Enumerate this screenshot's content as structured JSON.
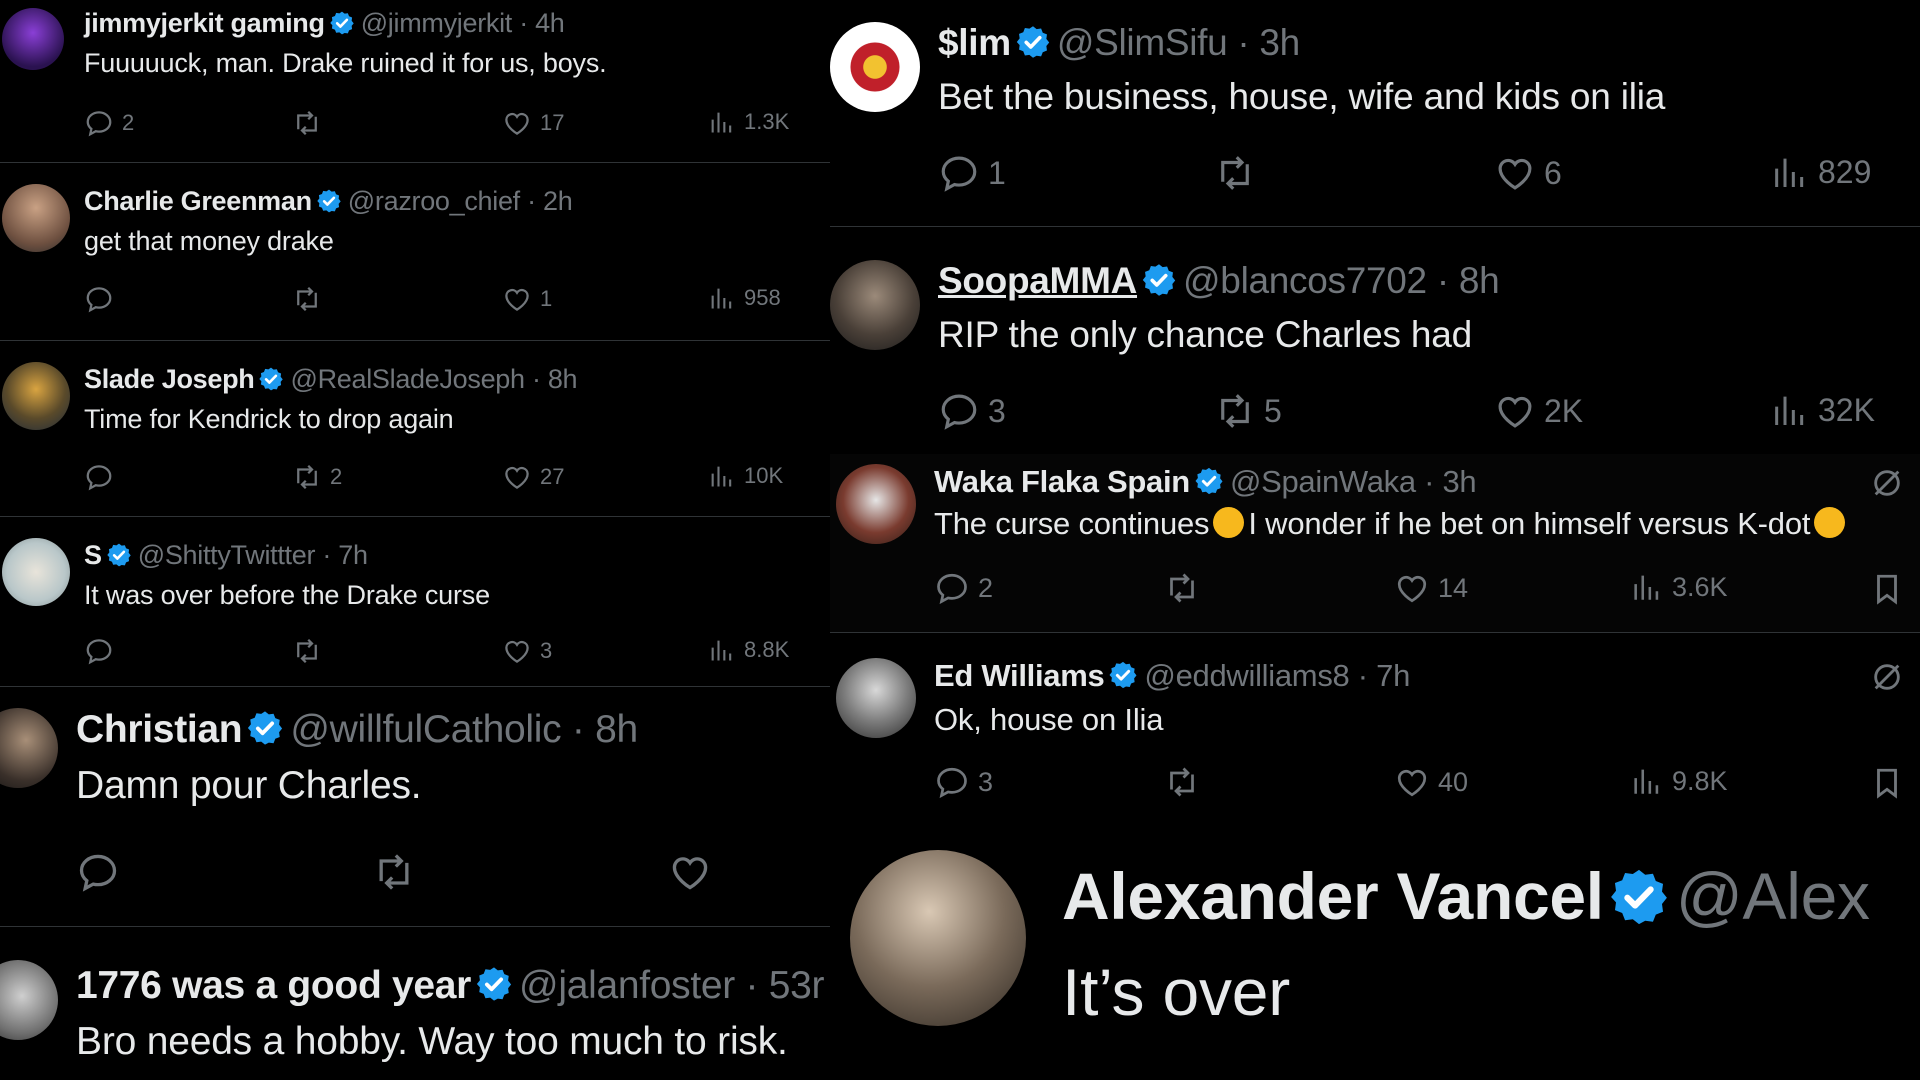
{
  "left_tweets": [
    {
      "name": "jimmyjerkit gaming",
      "handle": "@jimmyjerkit",
      "time": "4h",
      "text": "Fuuuuuck, man. Drake ruined it for us, boys.",
      "replies": "2",
      "retweets": "",
      "likes": "17",
      "views": "1.3K"
    },
    {
      "name": "Charlie Greenman",
      "handle": "@razroo_chief",
      "time": "2h",
      "text": "get that money drake",
      "replies": "",
      "retweets": "",
      "likes": "1",
      "views": "958"
    },
    {
      "name": "Slade Joseph",
      "handle": "@RealSladeJoseph",
      "time": "8h",
      "text": "Time for Kendrick to drop again",
      "replies": "",
      "retweets": "2",
      "likes": "27",
      "views": "10K"
    },
    {
      "name": "S",
      "handle": "@ShittyTwittter",
      "time": "7h",
      "text": "It was over before the Drake curse",
      "replies": "",
      "retweets": "",
      "likes": "3",
      "views": "8.8K"
    },
    {
      "name": "Christian",
      "handle": "@willfulCatholic",
      "time": "8h",
      "text": "Damn pour Charles.",
      "replies": "",
      "retweets": "",
      "likes": ""
    },
    {
      "name": "1776 was a good year",
      "handle": "@jalanfoster",
      "time": "53r",
      "text": "Bro needs a hobby. Way too much to risk."
    }
  ],
  "right_tweets": [
    {
      "name": "$lim",
      "handle": "@SlimSifu",
      "time": "3h",
      "text": "Bet the business, house, wife and kids on ilia",
      "replies": "1",
      "retweets": "",
      "likes": "6",
      "views": "829"
    },
    {
      "name": "SoopaMMA",
      "handle": "@blancos7702",
      "time": "8h",
      "text": "RIP the only chance Charles had",
      "replies": "3",
      "retweets": "5",
      "likes": "2K",
      "views": "32K"
    },
    {
      "name": "Waka Flaka Spain",
      "handle": "@SpainWaka",
      "time": "3h",
      "text_a": "The curse continues",
      "text_b": "I wonder if he bet on himself versus K-dot",
      "replies": "2",
      "retweets": "",
      "likes": "14",
      "views": "3.6K"
    },
    {
      "name": "Ed Williams",
      "handle": "@eddwilliams8",
      "time": "7h",
      "text": "Ok, house on Ilia",
      "replies": "3",
      "retweets": "",
      "likes": "40",
      "views": "9.8K"
    },
    {
      "name": "Alexander Vancel",
      "handle": "@Alex",
      "text": "It’s over"
    }
  ],
  "dot": "·",
  "icons": {
    "reply": "reply-icon",
    "retweet": "retweet-icon",
    "like": "like-icon",
    "views": "views-icon",
    "bookmark": "bookmark-icon",
    "grok": "grok-icon",
    "verified": "verified-badge-icon"
  },
  "colors": {
    "bg": "#000000",
    "text": "#e7e9ea",
    "muted": "#71767b",
    "verified": "#1d9bf0",
    "divider": "#2f3336"
  }
}
